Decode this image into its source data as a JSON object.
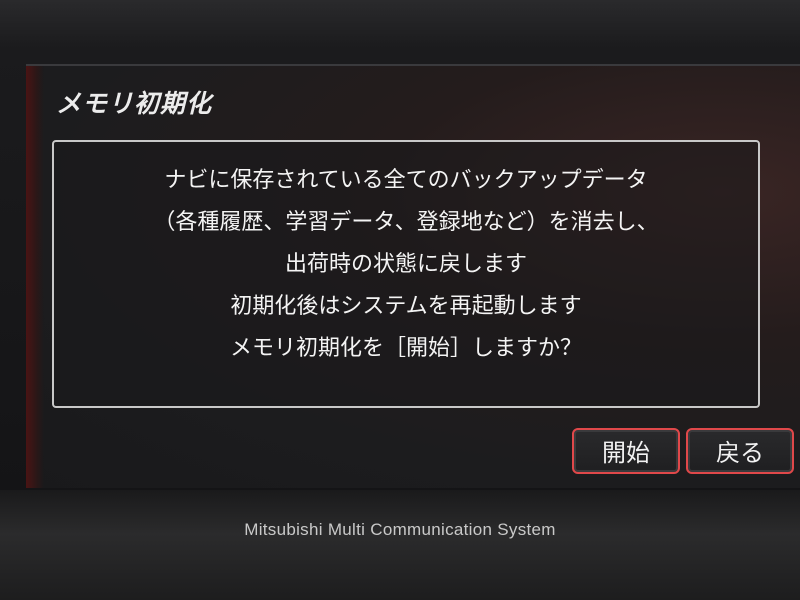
{
  "screen": {
    "title": "メモリ初期化"
  },
  "dialog": {
    "lines": [
      "ナビに保存されている全てのバックアップデータ",
      "（各種履歴、学習データ、登録地など）を消去し、",
      "出荷時の状態に戻します",
      "初期化後はシステムを再起動します",
      "メモリ初期化を［開始］しますか？"
    ]
  },
  "buttons": {
    "start_label": "開始",
    "back_label": "戻る"
  },
  "device": {
    "brand_text": "Mitsubishi Multi Communication System"
  },
  "colors": {
    "button_border": "#e0484a",
    "text": "#f4f4f4",
    "dialog_border": "#c8c8c8"
  }
}
